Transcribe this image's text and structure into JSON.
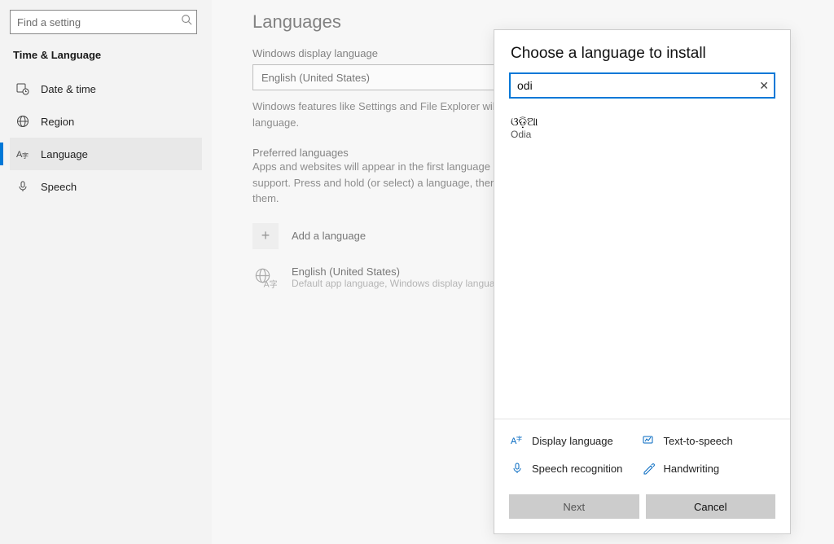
{
  "search": {
    "placeholder": "Find a setting"
  },
  "section_title": "Time & Language",
  "nav": {
    "items": [
      {
        "label": "Date & time"
      },
      {
        "label": "Region"
      },
      {
        "label": "Language"
      },
      {
        "label": "Speech"
      }
    ]
  },
  "main": {
    "title": "Languages",
    "display_label": "Windows display language",
    "display_value": "English (United States)",
    "display_help": "Windows features like Settings and File Explorer will appear in this language.",
    "preferred_label": "Preferred languages",
    "preferred_help": "Apps and websites will appear in the first language in the list that they support. Press and hold (or select) a language, then drag to rearrange them.",
    "add_language": "Add a language",
    "entries": [
      {
        "name": "English (United States)",
        "sub": "Default app language, Windows display language"
      }
    ]
  },
  "modal": {
    "title": "Choose a language to install",
    "search_value": "odi",
    "results": [
      {
        "native": "ଓଡ଼ିଆ",
        "english": "Odia"
      }
    ],
    "features": {
      "display": "Display language",
      "tts": "Text-to-speech",
      "speech": "Speech recognition",
      "handwriting": "Handwriting"
    },
    "buttons": {
      "next": "Next",
      "cancel": "Cancel"
    }
  }
}
